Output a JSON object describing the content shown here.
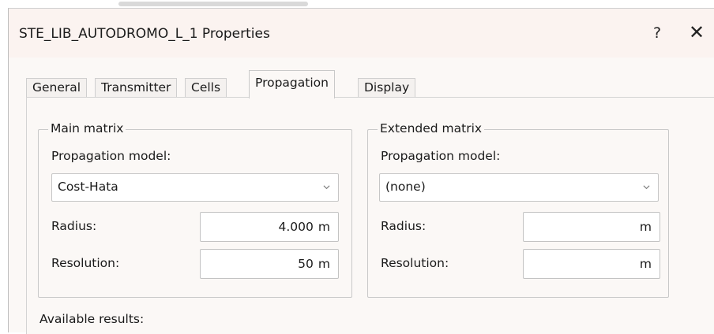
{
  "window": {
    "title": "STE_LIB_AUTODROMO_L_1 Properties",
    "help_label": "?",
    "close_label": "✕"
  },
  "tabs": [
    {
      "label": "General",
      "active": false
    },
    {
      "label": "Transmitter",
      "active": false
    },
    {
      "label": "Cells",
      "active": false
    },
    {
      "label": "Propagation",
      "active": true
    },
    {
      "label": "Display",
      "active": false
    }
  ],
  "main_matrix": {
    "title": "Main matrix",
    "model_label": "Propagation model:",
    "model_value": "Cost-Hata",
    "radius_label": "Radius:",
    "radius_value": "4.000",
    "radius_unit": "m",
    "resolution_label": "Resolution:",
    "resolution_value": "50",
    "resolution_unit": "m"
  },
  "extended_matrix": {
    "title": "Extended matrix",
    "model_label": "Propagation model:",
    "model_value": "(none)",
    "radius_label": "Radius:",
    "radius_value": "",
    "radius_unit": "m",
    "resolution_label": "Resolution:",
    "resolution_value": "",
    "resolution_unit": "m"
  },
  "available_results_label": "Available results:",
  "icons": {
    "chevron": "chevron-down-icon"
  },
  "colors": {
    "titlebar": "#fbf3f0",
    "dialog": "#fbf8f6",
    "border": "#c9c9c9"
  }
}
